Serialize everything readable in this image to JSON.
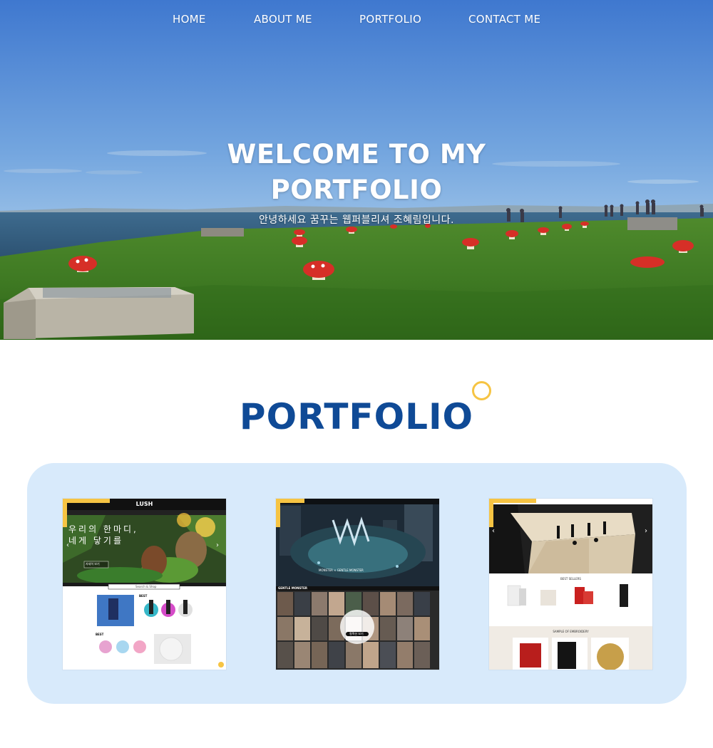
{
  "nav": {
    "items": [
      {
        "label": "HOME"
      },
      {
        "label": "ABOUT ME"
      },
      {
        "label": "PORTFOLIO"
      },
      {
        "label": "CONTACT ME"
      }
    ]
  },
  "hero": {
    "title_line1": "WELCOME TO MY",
    "title_line2": "PORTFOLIO",
    "subtitle": "안녕하세요 꿈꾸는 웹퍼블리셔 조혜림입니다."
  },
  "portfolio": {
    "title": "PORTFOLIO",
    "cards": [
      {
        "brand": "LUSH",
        "headline_line1": "우리의 한마디,",
        "headline_line2": "네게 닿기를",
        "search_placeholder": "Search & Shop",
        "section_label_1": "BEST",
        "section_label_2": "BEST",
        "cta_label": "자세히 보기"
      },
      {
        "hero_caption": "MONSTER × GENTLE MONSTER",
        "brand": "GENTLE MONSTER",
        "cta_label": "컬렉션 보기"
      },
      {
        "section_label_1": "BEST SELLERS",
        "section_label_2": "SAMPLE OF EMBROIDERY"
      }
    ]
  },
  "colors": {
    "accent_yellow": "#f6c443",
    "title_blue": "#0f4a96",
    "panel_blue": "#d8eafb"
  }
}
